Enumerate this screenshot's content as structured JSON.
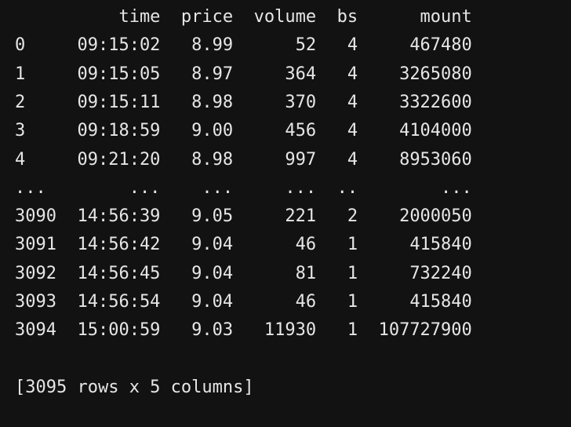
{
  "output": {
    "columns": [
      "time",
      "price",
      "volume",
      "bs",
      "mount"
    ],
    "rows": [
      {
        "index": "0",
        "time": "09:15:02",
        "price": "8.99",
        "volume": "52",
        "bs": "4",
        "mount": "467480"
      },
      {
        "index": "1",
        "time": "09:15:05",
        "price": "8.97",
        "volume": "364",
        "bs": "4",
        "mount": "3265080"
      },
      {
        "index": "2",
        "time": "09:15:11",
        "price": "8.98",
        "volume": "370",
        "bs": "4",
        "mount": "3322600"
      },
      {
        "index": "3",
        "time": "09:18:59",
        "price": "9.00",
        "volume": "456",
        "bs": "4",
        "mount": "4104000"
      },
      {
        "index": "4",
        "time": "09:21:20",
        "price": "8.98",
        "volume": "997",
        "bs": "4",
        "mount": "8953060"
      },
      {
        "index": "...",
        "time": "...",
        "price": "...",
        "volume": "...",
        "bs": "..",
        "mount": "..."
      },
      {
        "index": "3090",
        "time": "14:56:39",
        "price": "9.05",
        "volume": "221",
        "bs": "2",
        "mount": "2000050"
      },
      {
        "index": "3091",
        "time": "14:56:42",
        "price": "9.04",
        "volume": "46",
        "bs": "1",
        "mount": "415840"
      },
      {
        "index": "3092",
        "time": "14:56:45",
        "price": "9.04",
        "volume": "81",
        "bs": "1",
        "mount": "732240"
      },
      {
        "index": "3093",
        "time": "14:56:54",
        "price": "9.04",
        "volume": "46",
        "bs": "1",
        "mount": "415840"
      },
      {
        "index": "3094",
        "time": "15:00:59",
        "price": "9.03",
        "volume": "11930",
        "bs": "1",
        "mount": "107727900"
      }
    ],
    "summary": "[3095 rows x 5 columns]"
  },
  "colors": {
    "background": "#121212",
    "text": "#e6e6e6"
  }
}
